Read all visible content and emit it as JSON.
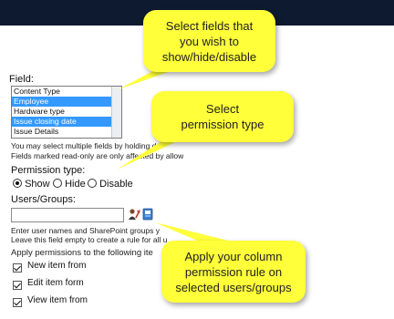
{
  "form": {
    "field_label": "Field:",
    "field_options": [
      "Content Type",
      "Employee",
      "Hardware type",
      "Issue closing date",
      "Issue Details"
    ],
    "hint_line1": "You may select multiple fields by holding do",
    "hint_line2": "Fields marked read-only are only affected by  allow",
    "permission_label": "Permission type:",
    "permission_options": [
      "Show",
      "Hide",
      "Disable"
    ],
    "permission_selected": "Show",
    "users_label": "Users/Groups:",
    "users_value": "",
    "users_hint1": "Enter user names and SharePoint groups y",
    "users_hint2": "Leave this field empty to create a rule for all u",
    "apply_label": "Apply permissions to the following ite",
    "apply_items": [
      "New item from",
      "Edit item form",
      "View item from"
    ]
  },
  "callouts": {
    "fields": "Select fields that you wish to show/hide/disable",
    "permission": "Select permission type",
    "users": "Apply your column permission rule on selected users/groups"
  },
  "colors": {
    "callout_bg": "#ffff3a",
    "selected_bg": "#3399ff",
    "top_bar": "#0d1a2f"
  },
  "icons": [
    "people-picker-icon",
    "address-book-icon"
  ]
}
